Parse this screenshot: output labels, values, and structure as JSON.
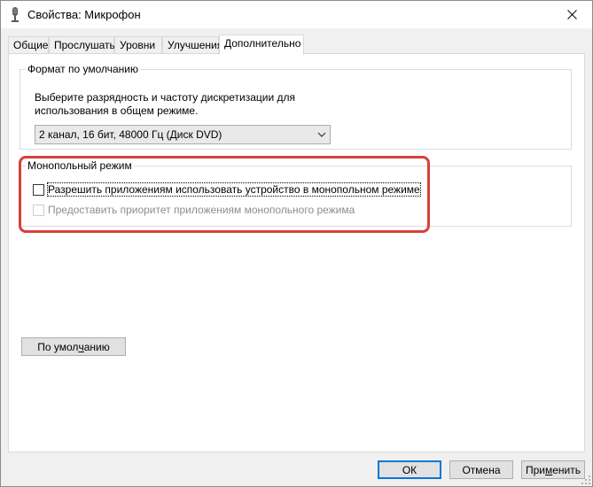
{
  "window": {
    "title": "Свойства: Микрофон",
    "icons": {
      "app": "microphone-icon",
      "close": "close-icon"
    }
  },
  "tabs": [
    {
      "label": "Общие",
      "active": false
    },
    {
      "label": "Прослушать",
      "active": false
    },
    {
      "label": "Уровни",
      "active": false
    },
    {
      "label": "Улучшения",
      "active": false
    },
    {
      "label": "Дополнительно",
      "active": true
    }
  ],
  "default_format": {
    "legend": "Формат по умолчанию",
    "description": "Выберите разрядность и частоту дискретизации для использования в общем режиме.",
    "selected_format": "2 канал, 16 бит, 48000 Гц (Диск DVD)"
  },
  "exclusive_mode": {
    "legend": "Монопольный режим",
    "allow_exclusive": {
      "label": "Разрешить приложениям использовать устройство в монопольном режиме",
      "checked": false
    },
    "give_priority": {
      "label": "Предоставить приоритет приложениям монопольного режима",
      "checked": false,
      "disabled": true
    }
  },
  "restore_defaults": {
    "label_before": "По умол",
    "label_underlined": "ч",
    "label_after": "анию"
  },
  "footer": {
    "ok": "ОК",
    "cancel": "Отмена",
    "apply_before": "При",
    "apply_underlined": "м",
    "apply_after": "енить"
  },
  "colors": {
    "highlight": "#d9403a",
    "default_button_border": "#0078d7"
  }
}
